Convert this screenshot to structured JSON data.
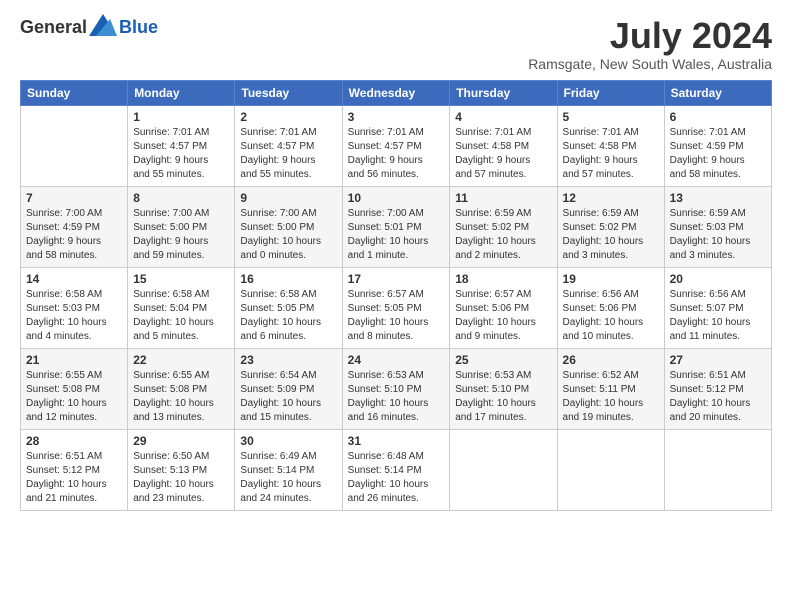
{
  "logo": {
    "text_general": "General",
    "text_blue": "Blue"
  },
  "title": "July 2024",
  "location": "Ramsgate, New South Wales, Australia",
  "days_of_week": [
    "Sunday",
    "Monday",
    "Tuesday",
    "Wednesday",
    "Thursday",
    "Friday",
    "Saturday"
  ],
  "weeks": [
    [
      {
        "day": "",
        "info": ""
      },
      {
        "day": "1",
        "info": "Sunrise: 7:01 AM\nSunset: 4:57 PM\nDaylight: 9 hours\nand 55 minutes."
      },
      {
        "day": "2",
        "info": "Sunrise: 7:01 AM\nSunset: 4:57 PM\nDaylight: 9 hours\nand 55 minutes."
      },
      {
        "day": "3",
        "info": "Sunrise: 7:01 AM\nSunset: 4:57 PM\nDaylight: 9 hours\nand 56 minutes."
      },
      {
        "day": "4",
        "info": "Sunrise: 7:01 AM\nSunset: 4:58 PM\nDaylight: 9 hours\nand 57 minutes."
      },
      {
        "day": "5",
        "info": "Sunrise: 7:01 AM\nSunset: 4:58 PM\nDaylight: 9 hours\nand 57 minutes."
      },
      {
        "day": "6",
        "info": "Sunrise: 7:01 AM\nSunset: 4:59 PM\nDaylight: 9 hours\nand 58 minutes."
      }
    ],
    [
      {
        "day": "7",
        "info": "Sunrise: 7:00 AM\nSunset: 4:59 PM\nDaylight: 9 hours\nand 58 minutes."
      },
      {
        "day": "8",
        "info": "Sunrise: 7:00 AM\nSunset: 5:00 PM\nDaylight: 9 hours\nand 59 minutes."
      },
      {
        "day": "9",
        "info": "Sunrise: 7:00 AM\nSunset: 5:00 PM\nDaylight: 10 hours\nand 0 minutes."
      },
      {
        "day": "10",
        "info": "Sunrise: 7:00 AM\nSunset: 5:01 PM\nDaylight: 10 hours\nand 1 minute."
      },
      {
        "day": "11",
        "info": "Sunrise: 6:59 AM\nSunset: 5:02 PM\nDaylight: 10 hours\nand 2 minutes."
      },
      {
        "day": "12",
        "info": "Sunrise: 6:59 AM\nSunset: 5:02 PM\nDaylight: 10 hours\nand 3 minutes."
      },
      {
        "day": "13",
        "info": "Sunrise: 6:59 AM\nSunset: 5:03 PM\nDaylight: 10 hours\nand 3 minutes."
      }
    ],
    [
      {
        "day": "14",
        "info": "Sunrise: 6:58 AM\nSunset: 5:03 PM\nDaylight: 10 hours\nand 4 minutes."
      },
      {
        "day": "15",
        "info": "Sunrise: 6:58 AM\nSunset: 5:04 PM\nDaylight: 10 hours\nand 5 minutes."
      },
      {
        "day": "16",
        "info": "Sunrise: 6:58 AM\nSunset: 5:05 PM\nDaylight: 10 hours\nand 6 minutes."
      },
      {
        "day": "17",
        "info": "Sunrise: 6:57 AM\nSunset: 5:05 PM\nDaylight: 10 hours\nand 8 minutes."
      },
      {
        "day": "18",
        "info": "Sunrise: 6:57 AM\nSunset: 5:06 PM\nDaylight: 10 hours\nand 9 minutes."
      },
      {
        "day": "19",
        "info": "Sunrise: 6:56 AM\nSunset: 5:06 PM\nDaylight: 10 hours\nand 10 minutes."
      },
      {
        "day": "20",
        "info": "Sunrise: 6:56 AM\nSunset: 5:07 PM\nDaylight: 10 hours\nand 11 minutes."
      }
    ],
    [
      {
        "day": "21",
        "info": "Sunrise: 6:55 AM\nSunset: 5:08 PM\nDaylight: 10 hours\nand 12 minutes."
      },
      {
        "day": "22",
        "info": "Sunrise: 6:55 AM\nSunset: 5:08 PM\nDaylight: 10 hours\nand 13 minutes."
      },
      {
        "day": "23",
        "info": "Sunrise: 6:54 AM\nSunset: 5:09 PM\nDaylight: 10 hours\nand 15 minutes."
      },
      {
        "day": "24",
        "info": "Sunrise: 6:53 AM\nSunset: 5:10 PM\nDaylight: 10 hours\nand 16 minutes."
      },
      {
        "day": "25",
        "info": "Sunrise: 6:53 AM\nSunset: 5:10 PM\nDaylight: 10 hours\nand 17 minutes."
      },
      {
        "day": "26",
        "info": "Sunrise: 6:52 AM\nSunset: 5:11 PM\nDaylight: 10 hours\nand 19 minutes."
      },
      {
        "day": "27",
        "info": "Sunrise: 6:51 AM\nSunset: 5:12 PM\nDaylight: 10 hours\nand 20 minutes."
      }
    ],
    [
      {
        "day": "28",
        "info": "Sunrise: 6:51 AM\nSunset: 5:12 PM\nDaylight: 10 hours\nand 21 minutes."
      },
      {
        "day": "29",
        "info": "Sunrise: 6:50 AM\nSunset: 5:13 PM\nDaylight: 10 hours\nand 23 minutes."
      },
      {
        "day": "30",
        "info": "Sunrise: 6:49 AM\nSunset: 5:14 PM\nDaylight: 10 hours\nand 24 minutes."
      },
      {
        "day": "31",
        "info": "Sunrise: 6:48 AM\nSunset: 5:14 PM\nDaylight: 10 hours\nand 26 minutes."
      },
      {
        "day": "",
        "info": ""
      },
      {
        "day": "",
        "info": ""
      },
      {
        "day": "",
        "info": ""
      }
    ]
  ]
}
